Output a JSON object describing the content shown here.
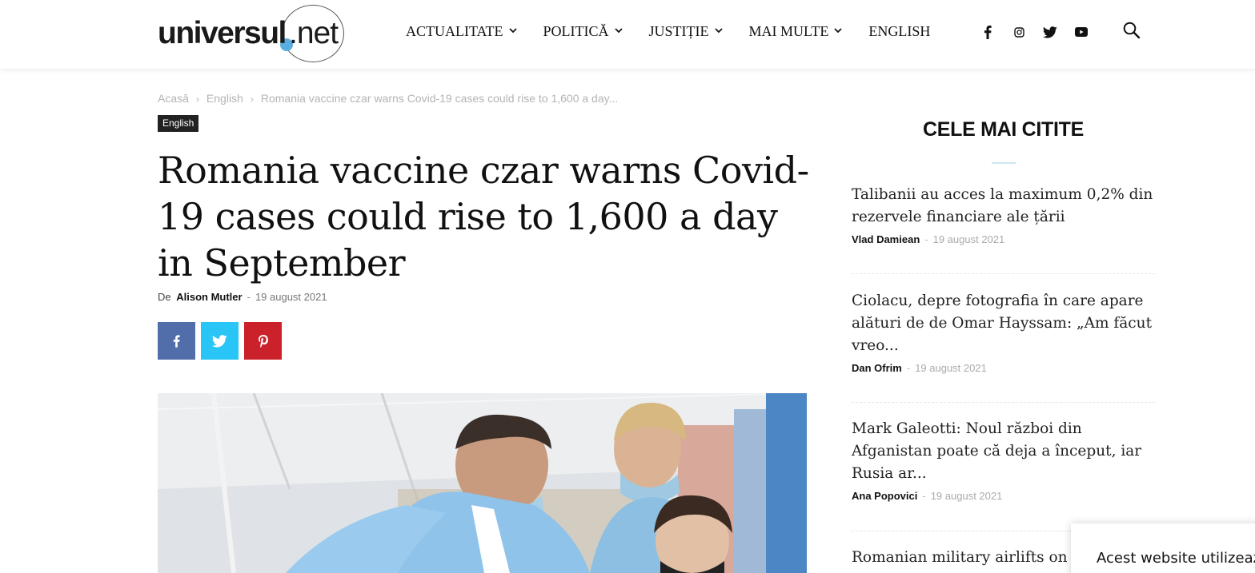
{
  "brand": {
    "logo_word": "universul",
    "logo_ext": ".net",
    "accent": "#5aaee0"
  },
  "nav": {
    "items": [
      {
        "label": "ACTUALITATE",
        "has_dropdown": true
      },
      {
        "label": "POLITICĂ",
        "has_dropdown": true
      },
      {
        "label": "JUSTIȚIE",
        "has_dropdown": true
      },
      {
        "label": "MAI MULTE",
        "has_dropdown": true
      },
      {
        "label": "ENGLISH",
        "has_dropdown": false
      }
    ],
    "social_icons": [
      "facebook-icon",
      "instagram-icon",
      "twitter-icon",
      "youtube-icon"
    ],
    "search_icon": "search-icon"
  },
  "breadcrumb": {
    "items": [
      "Acasă",
      "English",
      "Romania vaccine czar warns Covid-19 cases could rise to 1,600 a day..."
    ]
  },
  "article": {
    "category": "English",
    "title": "Romania vaccine czar warns Covid-19 cases could rise to 1,600 a day in September",
    "by_prefix": "De",
    "author": "Alison Mutler",
    "date": "19 august 2021",
    "share": [
      {
        "network": "facebook",
        "color": "#516eab"
      },
      {
        "network": "twitter",
        "color": "#29c5f6"
      },
      {
        "network": "pinterest",
        "color": "#ca212a"
      }
    ]
  },
  "sidebar": {
    "title": "CELE MAI CITITE",
    "items": [
      {
        "title": "Talibanii au acces la maximum 0,2% din rezervele financiare ale țării",
        "author": "Vlad Damiean",
        "date": "19 august 2021"
      },
      {
        "title": "Ciolacu, depre fotografia în care apare alături de de Omar Hayssam: „Am făcut vreo...",
        "author": "Dan Ofrim",
        "date": "19 august 2021"
      },
      {
        "title": "Mark Galeotti: Noul război din Afganistan poate că deja a început, iar Rusia ar...",
        "author": "Ana Popovici",
        "date": "19 august 2021"
      },
      {
        "title": "Romanian military airlifts on"
      }
    ]
  },
  "cookie": {
    "text": "Acest website utilizeaz"
  }
}
